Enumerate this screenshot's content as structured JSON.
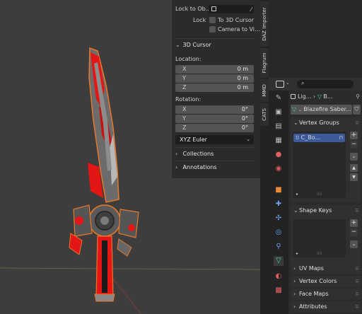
{
  "npanel": {
    "lock_to_object_label": "Lock to Ob...",
    "lock_label": "Lock",
    "to_3d_cursor_label": "To 3D Cursor",
    "camera_to_view_label": "Camera to Vi...",
    "cursor_section_title": "3D Cursor",
    "location_label": "Location:",
    "location": [
      {
        "axis": "X",
        "value": "0 m"
      },
      {
        "axis": "Y",
        "value": "0 m"
      },
      {
        "axis": "Z",
        "value": "0 m"
      }
    ],
    "rotation_label": "Rotation:",
    "rotation": [
      {
        "axis": "X",
        "value": "0°"
      },
      {
        "axis": "Y",
        "value": "0°"
      },
      {
        "axis": "Z",
        "value": "0°"
      }
    ],
    "rotation_mode": "XYZ Euler",
    "collections_label": "Collections",
    "annotations_label": "Annotations"
  },
  "vtabs": [
    "DAZ Importer",
    "Flagrum",
    "MMD",
    "CATS"
  ],
  "properties": {
    "breadcrumb_left": "Lig...",
    "breadcrumb_right": "B...",
    "mesh_name": "Blazefire Saber...",
    "vertex_groups_title": "Vertex Groups",
    "vertex_group_item": "C_Bo...",
    "shape_keys_title": "Shape Keys",
    "uv_maps_title": "UV Maps",
    "vertex_colors_title": "Vertex Colors",
    "face_maps_title": "Face Maps",
    "attributes_title": "Attributes"
  },
  "colors": {
    "selection_outline": "#e8782a",
    "blade_red": "#e31515",
    "accent_green": "#3fd6a0",
    "vertex_group_highlight": "#3c5a9a"
  }
}
